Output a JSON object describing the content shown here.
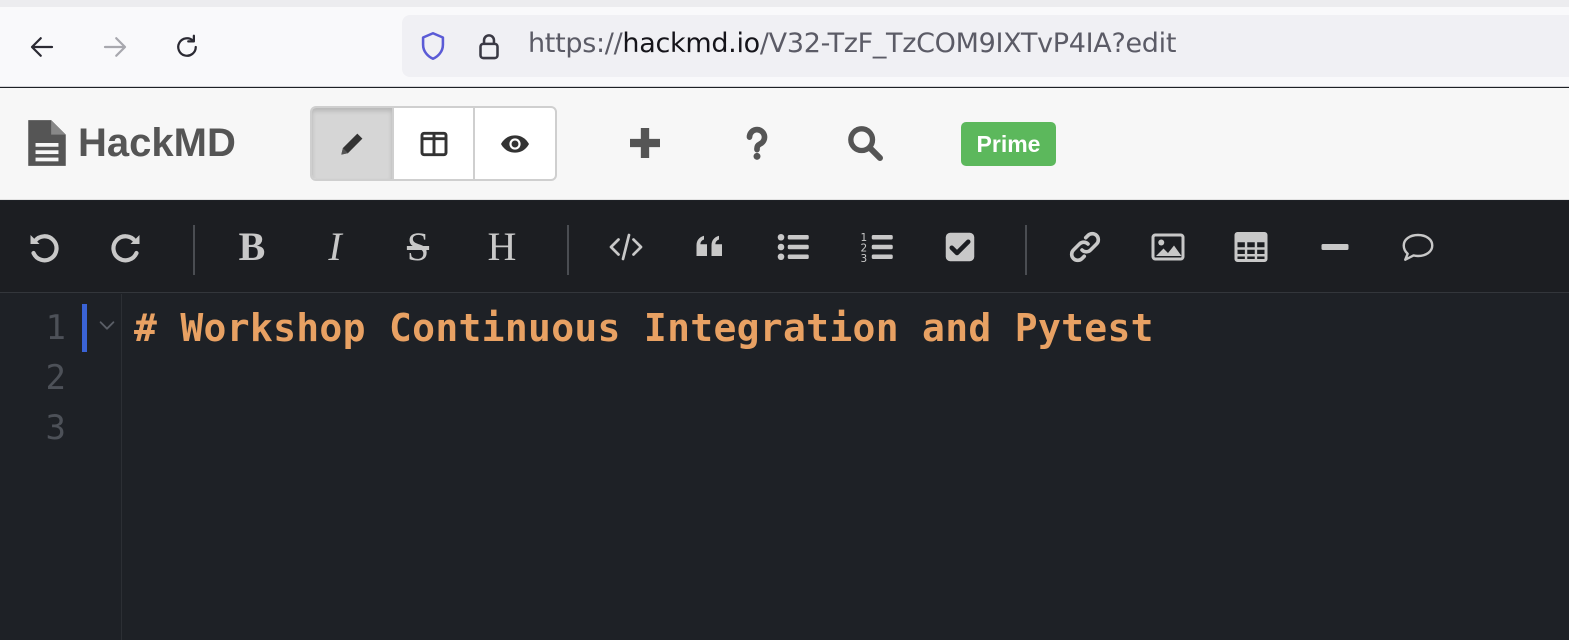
{
  "browser": {
    "url_scheme": "https://",
    "url_host": "hackmd.io",
    "url_path": "/V32-TzF_TzCOM9IXTvP4IA?edit",
    "icons": [
      "back-arrow-icon",
      "forward-arrow-icon",
      "reload-icon",
      "shield-icon",
      "lock-icon"
    ]
  },
  "header": {
    "brand": "HackMD",
    "modes": [
      "edit",
      "split",
      "view"
    ],
    "active_mode": "edit",
    "actions": [
      "plus-icon",
      "help-icon",
      "search-icon"
    ],
    "prime_label": "Prime",
    "prime_color": "#5cb85c"
  },
  "toolbar": {
    "buttons": [
      "undo",
      "redo",
      "bold",
      "italic",
      "strikethrough",
      "heading",
      "code",
      "quote",
      "bulleted-list",
      "numbered-list",
      "checklist",
      "link",
      "image",
      "table",
      "horizontal-rule",
      "comment"
    ],
    "bold_glyph": "B",
    "italic_glyph": "I",
    "strike_glyph": "S",
    "heading_glyph": "H"
  },
  "editor": {
    "line_numbers": [
      "1",
      "2",
      "3"
    ],
    "lines": [
      "# Workshop Continuous Integration and Pytest",
      "",
      ""
    ],
    "heading_color": "#e8a163"
  }
}
